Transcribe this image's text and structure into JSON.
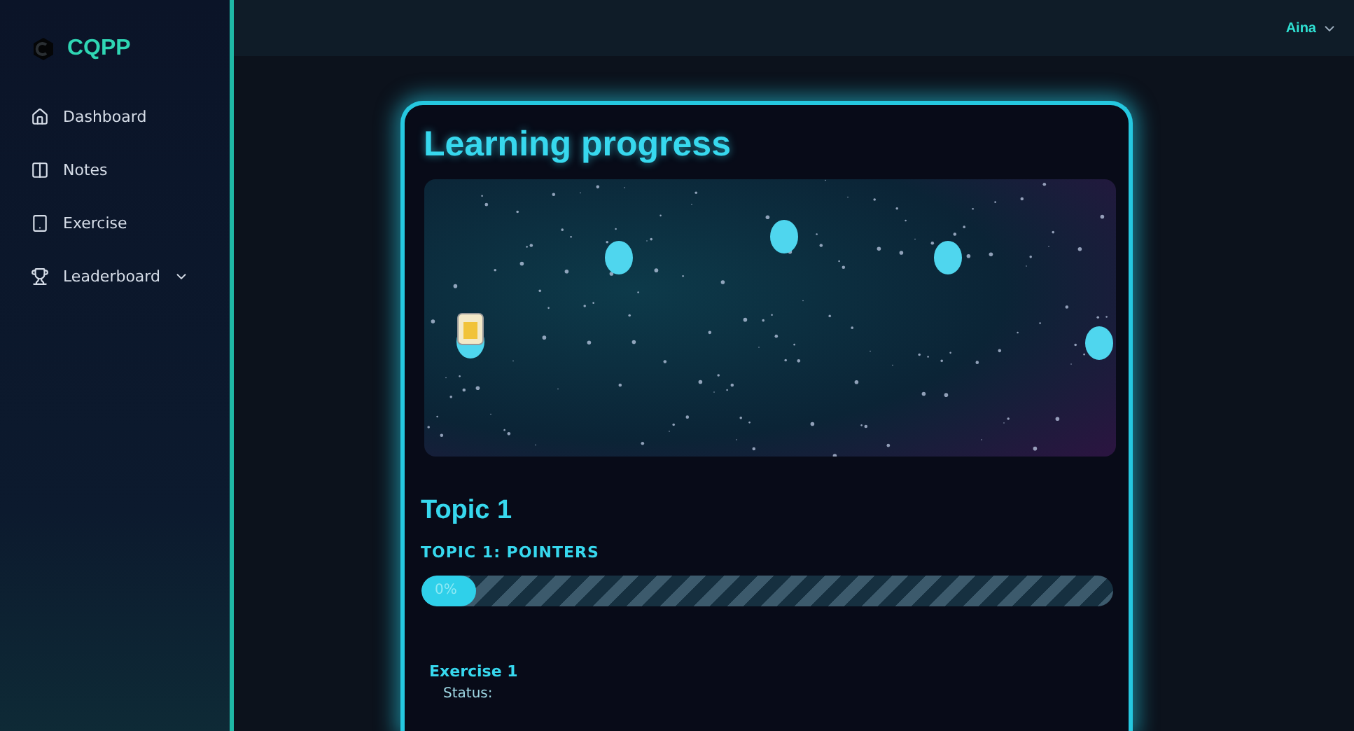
{
  "sidebar": {
    "logo": "CQPP",
    "items": [
      {
        "label": "Dashboard",
        "selected": false,
        "has_dropdown": false
      },
      {
        "label": "Notes",
        "selected": false,
        "has_dropdown": false
      },
      {
        "label": "Exercise",
        "selected": false,
        "has_dropdown": false
      },
      {
        "label": "Leaderboard",
        "selected": false,
        "has_dropdown": true
      }
    ]
  },
  "topbar": {
    "user": "Aina"
  },
  "card": {
    "title": "Learning progress",
    "topic": {
      "title": "Topic 1",
      "subtitle": "TOPIC 1: POINTERS",
      "progress": {
        "level": 0.08,
        "reading": "0%"
      }
    },
    "exercise": {
      "title": "Exercise 1",
      "status_label": "Status:"
    }
  }
}
